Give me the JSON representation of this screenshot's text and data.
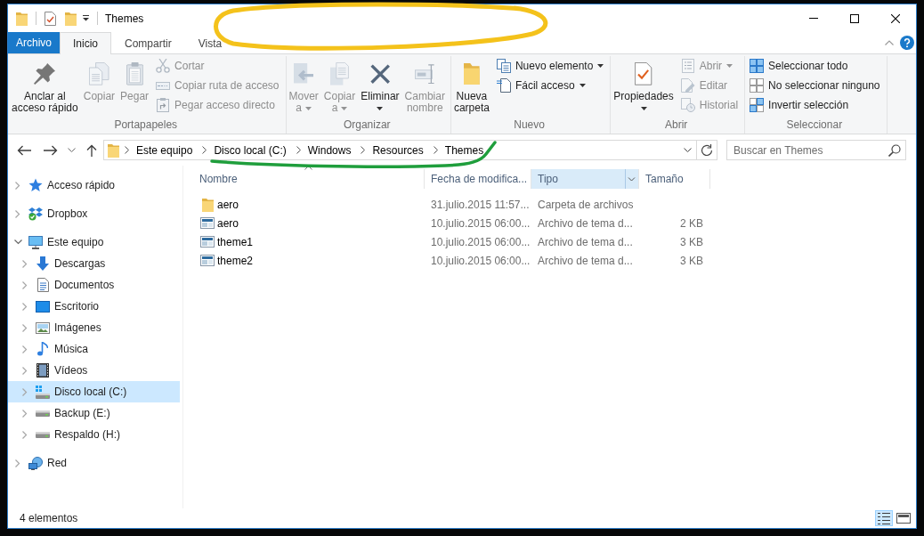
{
  "window": {
    "title": "Themes"
  },
  "ribbon": {
    "tabs": [
      {
        "label": "Archivo",
        "kind": "menu",
        "selected": false
      },
      {
        "label": "Inicio",
        "kind": "tab",
        "selected": true
      },
      {
        "label": "Compartir",
        "kind": "tab",
        "selected": false
      },
      {
        "label": "Vista",
        "kind": "tab",
        "selected": false
      }
    ],
    "groups": [
      {
        "label": "Portapapeles",
        "items": [
          {
            "kind": "large",
            "label": "Anclar al\nacceso rápido",
            "disabled": false,
            "dropdown": false
          },
          {
            "kind": "large",
            "label": "Copiar",
            "disabled": true,
            "dropdown": false
          },
          {
            "kind": "large",
            "label": "Pegar",
            "disabled": true,
            "dropdown": false
          },
          {
            "kind": "small",
            "label": "Cortar",
            "disabled": true,
            "dropdown": false
          },
          {
            "kind": "small",
            "label": "Copiar ruta de acceso",
            "disabled": true,
            "dropdown": false
          },
          {
            "kind": "small",
            "label": "Pegar acceso directo",
            "disabled": true,
            "dropdown": false
          }
        ]
      },
      {
        "label": "Organizar",
        "items": [
          {
            "kind": "large",
            "label": "Mover\na",
            "disabled": true,
            "dropdown": true
          },
          {
            "kind": "large",
            "label": "Copiar\na",
            "disabled": true,
            "dropdown": true
          },
          {
            "kind": "large",
            "label": "Eliminar",
            "disabled": false,
            "dropdown": true
          },
          {
            "kind": "large",
            "label": "Cambiar\nnombre",
            "disabled": true,
            "dropdown": false
          }
        ]
      },
      {
        "label": "Nuevo",
        "items": [
          {
            "kind": "large",
            "label": "Nueva\ncarpeta",
            "disabled": false,
            "dropdown": false
          },
          {
            "kind": "small",
            "label": "Nuevo elemento",
            "disabled": false,
            "dropdown": true
          },
          {
            "kind": "small",
            "label": "Fácil acceso",
            "disabled": false,
            "dropdown": true
          }
        ]
      },
      {
        "label": "Abrir",
        "items": [
          {
            "kind": "large",
            "label": "Propiedades",
            "disabled": false,
            "dropdown": true
          },
          {
            "kind": "small",
            "label": "Abrir",
            "disabled": true,
            "dropdown": true
          },
          {
            "kind": "small",
            "label": "Editar",
            "disabled": true,
            "dropdown": false
          },
          {
            "kind": "small",
            "label": "Historial",
            "disabled": true,
            "dropdown": false
          }
        ]
      },
      {
        "label": "Seleccionar",
        "items": [
          {
            "kind": "small",
            "label": "Seleccionar todo",
            "disabled": false,
            "dropdown": false
          },
          {
            "kind": "small",
            "label": "No seleccionar ninguno",
            "disabled": false,
            "dropdown": false
          },
          {
            "kind": "small",
            "label": "Invertir selección",
            "disabled": false,
            "dropdown": false
          }
        ]
      }
    ]
  },
  "address_bar": {
    "breadcrumbs": [
      "Este equipo",
      "Disco local (C:)",
      "Windows",
      "Resources",
      "Themes"
    ]
  },
  "search": {
    "placeholder": "Buscar en Themes"
  },
  "navigation_pane": {
    "items": [
      {
        "kind": "favorites",
        "label": "Acceso rápido",
        "expanded": false,
        "selected": false
      },
      {
        "kind": "cloud",
        "label": "Dropbox",
        "expanded": false,
        "selected": false
      },
      {
        "kind": "computer",
        "label": "Este equipo",
        "expanded": true,
        "selected": false,
        "children": [
          {
            "kind": "downloads",
            "label": "Descargas",
            "expanded": false,
            "selected": false
          },
          {
            "kind": "documents",
            "label": "Documentos",
            "expanded": false,
            "selected": false
          },
          {
            "kind": "desktop",
            "label": "Escritorio",
            "expanded": false,
            "selected": false
          },
          {
            "kind": "pictures",
            "label": "Imágenes",
            "expanded": false,
            "selected": false
          },
          {
            "kind": "music",
            "label": "Música",
            "expanded": false,
            "selected": false
          },
          {
            "kind": "videos",
            "label": "Vídeos",
            "expanded": false,
            "selected": false
          },
          {
            "kind": "system",
            "label": "Disco local (C:)",
            "expanded": false,
            "selected": true
          },
          {
            "kind": "drive",
            "label": "Backup (E:)",
            "expanded": false,
            "selected": false
          },
          {
            "kind": "drive",
            "label": "Respaldo (H:)",
            "expanded": false,
            "selected": false
          }
        ]
      },
      {
        "kind": "network",
        "label": "Red",
        "expanded": false,
        "selected": false
      }
    ]
  },
  "file_list": {
    "columns": [
      {
        "label": "Nombre",
        "sorted": true,
        "highlighted": false
      },
      {
        "label": "Fecha de modifica...",
        "sorted": false,
        "highlighted": false
      },
      {
        "label": "Tipo",
        "sorted": false,
        "highlighted": true
      },
      {
        "label": "Tamaño",
        "sorted": false,
        "highlighted": false
      }
    ],
    "rows": [
      {
        "kind": "folder",
        "name": "aero",
        "modified": "31.julio.2015 11:57...",
        "type": "Carpeta de archivos"
      },
      {
        "kind": "theme",
        "name": "aero",
        "modified": "10.julio.2015 06:00...",
        "type": "Archivo de tema d...",
        "size": "2 KB"
      },
      {
        "kind": "theme",
        "name": "theme1",
        "modified": "10.julio.2015 06:00...",
        "type": "Archivo de tema d...",
        "size": "3 KB"
      },
      {
        "kind": "theme",
        "name": "theme2",
        "modified": "10.julio.2015 06:00...",
        "type": "Archivo de tema d...",
        "size": "3 KB"
      }
    ]
  },
  "status_bar": {
    "item_count": "4 elementos",
    "views": [
      {
        "selected": true
      },
      {
        "selected": false
      }
    ]
  },
  "annotations": [
    {
      "kind": "ellipse",
      "color": "#f4c21b"
    },
    {
      "kind": "underline",
      "color": "#1f9e3c"
    }
  ]
}
